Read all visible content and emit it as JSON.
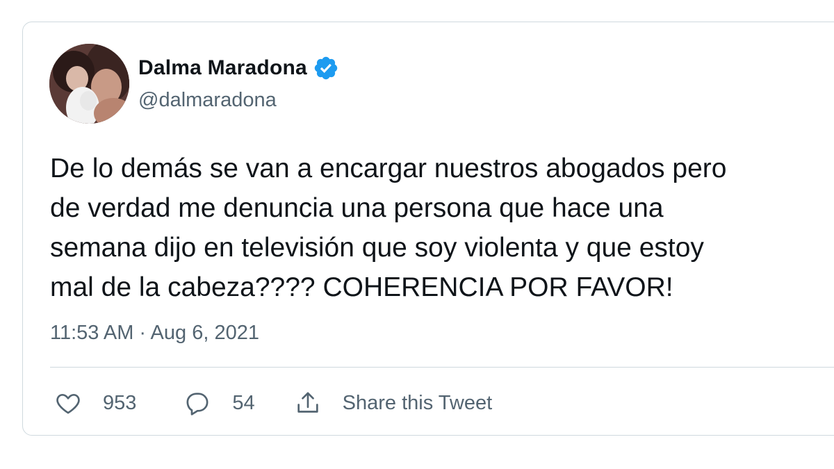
{
  "tweet": {
    "author": {
      "display_name": "Dalma Maradona",
      "handle": "@dalmaradona",
      "verified": true,
      "avatar_icon": "profile-photo"
    },
    "text_lines": [
      "De lo demás se van a encargar nuestros abogados pero",
      "de verdad me denuncia una persona que hace una",
      "semana dijo en televisión que soy violenta y que estoy",
      "mal de la cabeza???? COHERENCIA POR FAVOR!"
    ],
    "timestamp": "11:53 AM · Aug 6, 2021",
    "actions": {
      "like_count": "953",
      "reply_count": "54",
      "share_label": "Share this Tweet"
    }
  },
  "colors": {
    "text_primary": "#0f1419",
    "text_secondary": "#536471",
    "border": "#cfd9de",
    "verified_blue": "#1d9bf0"
  }
}
